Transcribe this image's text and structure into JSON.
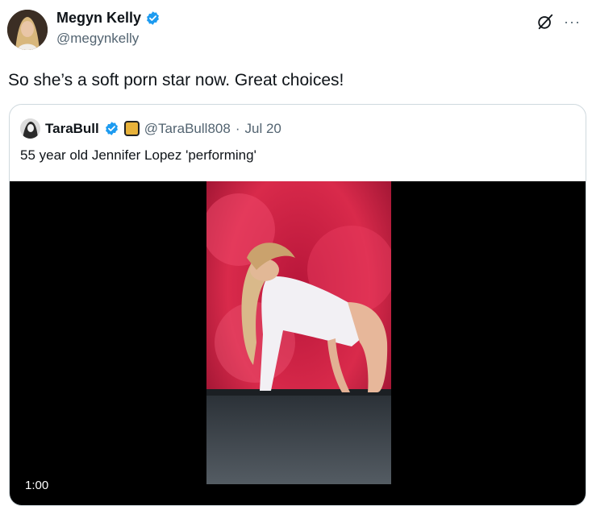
{
  "tweet": {
    "author": {
      "name": "Megyn Kelly",
      "handle": "@megynkelly"
    },
    "text": "So she’s a soft porn star now. Great choices!",
    "more_label": "···"
  },
  "quoted": {
    "name": "TaraBull",
    "handle": "@TaraBull808",
    "separator": "·",
    "date": "Jul 20",
    "text": "55 year old Jennifer Lopez 'performing'",
    "video_duration": "1:00"
  },
  "colors": {
    "verified": "#1d9bf0",
    "secondary_text": "#536471",
    "border": "#cfd9de",
    "stage_red": "#d4264a"
  },
  "icons": {
    "verified": "verified-badge-icon",
    "grok": "grok-icon",
    "more": "more-icon"
  }
}
